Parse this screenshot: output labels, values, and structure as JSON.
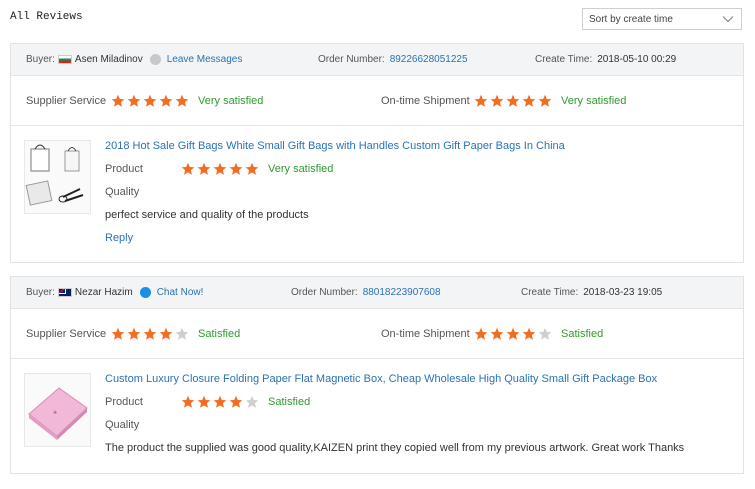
{
  "header": {
    "title": "All Reviews"
  },
  "sort": {
    "selected": "Sort by create time"
  },
  "colors": {
    "star_on": "#f36c21",
    "star_off": "#cfcfcf",
    "link": "#2a72b5",
    "verdict": "#2e9b2e"
  },
  "reviews": [
    {
      "buyer_label": "Buyer:",
      "buyer_name": "Asen Miladinov",
      "flag": "bulgaria-flag",
      "contact_label": "Leave Messages",
      "order_label": "Order Number:",
      "order_number": "89226628051225",
      "time_label": "Create Time:",
      "create_time": "2018-05-10 00:29",
      "supplier_service": {
        "label": "Supplier Service",
        "stars": 5,
        "verdict": "Very satisfied"
      },
      "ontime_shipment": {
        "label": "On-time Shipment",
        "stars": 5,
        "verdict": "Very satisfied"
      },
      "product": {
        "title": "2018 Hot Sale Gift Bags White Small Gift Bags with Handles Custom Gift Paper Bags In China",
        "product_label": "Product",
        "product_stars": 5,
        "product_verdict": "Very satisfied",
        "quality_label": "Quality",
        "comment": "perfect service and quality of the products",
        "reply_label": "Reply"
      }
    },
    {
      "buyer_label": "Buyer:",
      "buyer_name": "Nezar Hazim",
      "flag": "australia-flag",
      "contact_label": "Chat Now!",
      "order_label": "Order Number:",
      "order_number": "88018223907608",
      "time_label": "Create Time:",
      "create_time": "2018-03-23 19:05",
      "supplier_service": {
        "label": "Supplier Service",
        "stars": 4,
        "verdict": "Satisfied"
      },
      "ontime_shipment": {
        "label": "On-time Shipment",
        "stars": 4,
        "verdict": "Satisfied"
      },
      "product": {
        "title": "Custom Luxury Closure Folding Paper Flat Magnetic Box, Cheap Wholesale High Quality Small Gift Package Box",
        "product_label": "Product",
        "product_stars": 4,
        "product_verdict": "Satisfied",
        "quality_label": "Quality",
        "comment": "The product the supplied was good quality,KAIZEN print they copied well from my previous artwork. Great work Thanks"
      }
    }
  ]
}
